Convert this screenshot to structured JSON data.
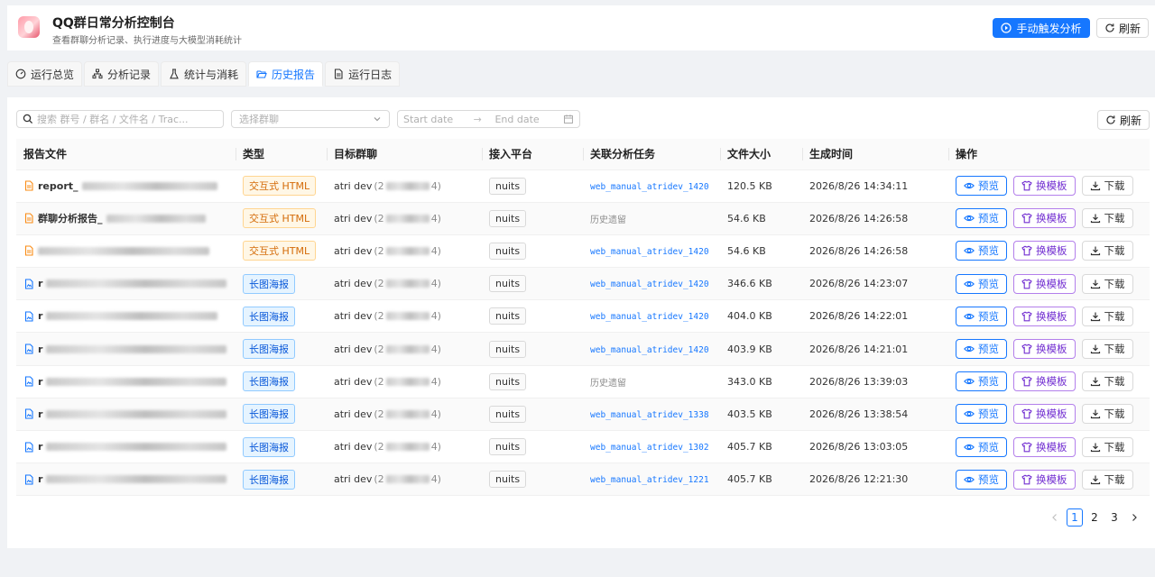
{
  "app": {
    "title": "QQ群日常分析控制台",
    "subtitle": "查看群聊分析记录、执行进度与大模型消耗统计",
    "trigger_label": "手动触发分析",
    "refresh_label": "刷新"
  },
  "tabs": [
    {
      "label": "运行总览",
      "icon": "dashboard-icon"
    },
    {
      "label": "分析记录",
      "icon": "sitemap-icon"
    },
    {
      "label": "统计与消耗",
      "icon": "beaker-icon"
    },
    {
      "label": "历史报告",
      "icon": "folder-open-icon",
      "active": true
    },
    {
      "label": "运行日志",
      "icon": "file-text-icon"
    }
  ],
  "filters": {
    "search_placeholder": "搜索 群号 / 群名 / 文件名 / Trac...",
    "group_placeholder": "选择群聊",
    "start_placeholder": "Start date",
    "end_placeholder": "End date",
    "refresh_label": "刷新"
  },
  "table": {
    "headers": [
      "报告文件",
      "类型",
      "目标群聊",
      "接入平台",
      "关联分析任务",
      "文件大小",
      "生成时间",
      "操作"
    ],
    "actions": {
      "preview": "预览",
      "template": "换模板",
      "download": "下载"
    },
    "rows": [
      {
        "file_prefix": "report_",
        "type": "交互式 HTML",
        "type_kind": "html",
        "group": "atri dev",
        "group_open": "(2",
        "group_close": "4)",
        "platform": "nuits",
        "task": "web_manual_atridev_1420",
        "task_kind": "link",
        "size": "120.5 KB",
        "time": "2026/8/26 14:34:11"
      },
      {
        "file_prefix": "群聊分析报告_",
        "type": "交互式 HTML",
        "type_kind": "html",
        "group": "atri dev",
        "group_open": "(2",
        "group_close": "4)",
        "platform": "nuits",
        "task": "历史遗留",
        "task_kind": "muted",
        "size": "54.6 KB",
        "time": "2026/8/26 14:26:58"
      },
      {
        "file_prefix": "",
        "type": "交互式 HTML",
        "type_kind": "html",
        "group": "atri dev",
        "group_open": "(2",
        "group_close": "4)",
        "platform": "nuits",
        "task": "web_manual_atridev_1420",
        "task_kind": "link",
        "size": "54.6 KB",
        "time": "2026/8/26 14:26:58"
      },
      {
        "file_prefix": "r",
        "type": "长图海报",
        "type_kind": "poster",
        "group": "atri dev",
        "group_open": "(2",
        "group_close": "4)",
        "platform": "nuits",
        "task": "web_manual_atridev_1420",
        "task_kind": "link",
        "size": "346.6 KB",
        "time": "2026/8/26 14:23:07"
      },
      {
        "file_prefix": "r",
        "type": "长图海报",
        "type_kind": "poster",
        "group": "atri dev",
        "group_open": "(2",
        "group_close": "4)",
        "platform": "nuits",
        "task": "web_manual_atridev_1420",
        "task_kind": "link",
        "size": "404.0 KB",
        "time": "2026/8/26 14:22:01"
      },
      {
        "file_prefix": "r",
        "type": "长图海报",
        "type_kind": "poster",
        "group": "atri dev",
        "group_open": "(2",
        "group_close": "4)",
        "platform": "nuits",
        "task": "web_manual_atridev_1420",
        "task_kind": "link",
        "size": "403.9 KB",
        "time": "2026/8/26 14:21:01"
      },
      {
        "file_prefix": "r",
        "type": "长图海报",
        "type_kind": "poster",
        "group": "atri dev",
        "group_open": "(2",
        "group_close": "4)",
        "platform": "nuits",
        "task": "历史遗留",
        "task_kind": "muted",
        "size": "343.0 KB",
        "time": "2026/8/26 13:39:03"
      },
      {
        "file_prefix": "r",
        "type": "长图海报",
        "type_kind": "poster",
        "group": "atri dev",
        "group_open": "(2",
        "group_close": "4)",
        "platform": "nuits",
        "task": "web_manual_atridev_1338",
        "task_kind": "link",
        "size": "403.5 KB",
        "time": "2026/8/26 13:38:54"
      },
      {
        "file_prefix": "r",
        "type": "长图海报",
        "type_kind": "poster",
        "group": "atri dev",
        "group_open": "(2",
        "group_close": "4)",
        "platform": "nuits",
        "task": "web_manual_atridev_1302",
        "task_kind": "link",
        "size": "405.7 KB",
        "time": "2026/8/26 13:03:05"
      },
      {
        "file_prefix": "r",
        "type": "长图海报",
        "type_kind": "poster",
        "group": "atri dev",
        "group_open": "(2",
        "group_close": "4)",
        "platform": "nuits",
        "task": "web_manual_atridev_1221",
        "task_kind": "link",
        "size": "405.7 KB",
        "time": "2026/8/26 12:21:30"
      }
    ]
  },
  "pagination": {
    "pages": [
      "1",
      "2",
      "3"
    ],
    "current": "1"
  },
  "colors": {
    "primary": "#1677ff",
    "template": "#722ed1",
    "html_tag": "#d46b08"
  }
}
